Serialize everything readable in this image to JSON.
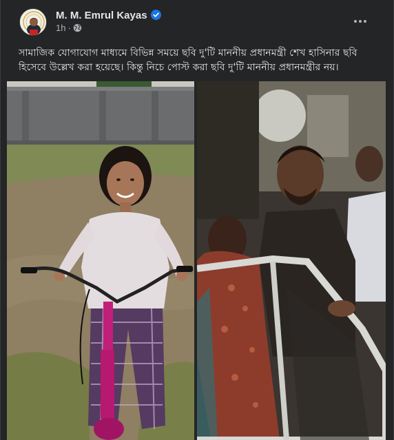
{
  "post": {
    "author": "M. M. Emrul Kayas",
    "time": "1h",
    "verified_icon": "verified-badge-icon",
    "privacy_icon": "globe-icon",
    "more_icon": "more-options-icon",
    "caption_line1": "সামাজিক যোগাযোগ মাধ্যমে বিভিন্ন সময়ে ছবি দু'টি মাননীয় প্রধানমন্ত্রী শেখ হাসিনার ছবি",
    "caption_line2": "হিসেবে উল্লেখ করা হয়েছে। কিন্তু নিচে পোস্ট করা ছবি দু'টি মাননীয় প্রধানমন্ত্রীর নয়।"
  },
  "photos": [
    {
      "name": "girl-on-bicycle-photo"
    },
    {
      "name": "man-beside-car-photo"
    }
  ],
  "colors": {
    "background": "#242526",
    "text": "#e4e6eb",
    "secondary_text": "#b0b3b8",
    "verified_blue": "#1b74e4"
  }
}
